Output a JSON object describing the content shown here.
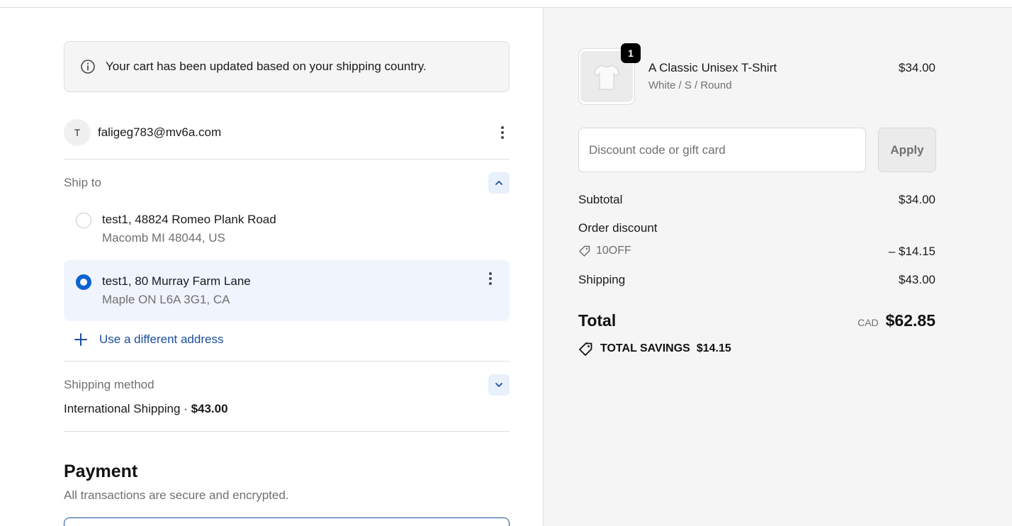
{
  "banner": {
    "text": "Your cart has been updated based on your shipping country."
  },
  "contact": {
    "avatar_initial": "T",
    "email": "faligeg783@mv6a.com"
  },
  "ship_to": {
    "label": "Ship to",
    "addresses": [
      {
        "line1": "test1, 48824 Romeo Plank Road",
        "line2": "Macomb MI 48044, US",
        "selected": false
      },
      {
        "line1": "test1, 80 Murray Farm Lane",
        "line2": "Maple ON L6A 3G1, CA",
        "selected": true
      }
    ],
    "use_different_label": "Use a different address"
  },
  "shipping_method": {
    "label": "Shipping method",
    "name": "International Shipping · ",
    "price": "$43.00"
  },
  "payment": {
    "title": "Payment",
    "subtitle": "All transactions are secure and encrypted."
  },
  "summary": {
    "product": {
      "quantity": "1",
      "name": "A Classic Unisex T-Shirt",
      "variant": "White / S / Round",
      "price": "$34.00"
    },
    "discount": {
      "placeholder": "Discount code or gift card",
      "apply_label": "Apply"
    },
    "subtotal_label": "Subtotal",
    "subtotal_value": "$34.00",
    "order_discount_label": "Order discount",
    "discount_code": "10OFF",
    "discount_value": "– $14.15",
    "shipping_label": "Shipping",
    "shipping_value": "$43.00",
    "total_label": "Total",
    "currency": "CAD",
    "total_value": "$62.85",
    "savings_label": "TOTAL SAVINGS",
    "savings_value": "$14.15"
  },
  "colors": {
    "accent": "#0b63d1",
    "link": "#1b4e9b",
    "selected_bg": "#f0f4fd",
    "summary_bg": "#f5f5f5"
  }
}
